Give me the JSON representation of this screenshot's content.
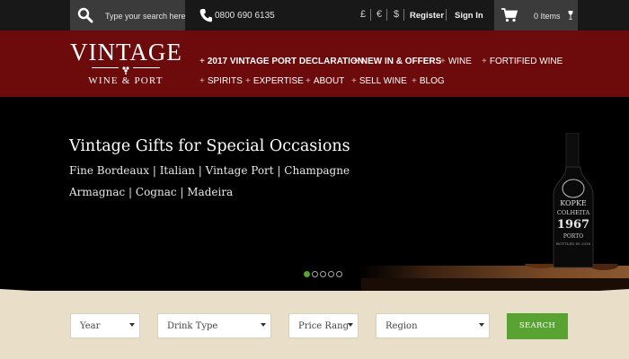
{
  "topbar": {
    "search_placeholder": "Type your search here",
    "phone": "0800 690 6135",
    "currencies": [
      "£",
      "€",
      "$"
    ],
    "register_label": "Register",
    "signin_label": "Sign In",
    "basket_label": "0 Items"
  },
  "logo": {
    "main": "VINTAGE",
    "sub": "WINE & PORT"
  },
  "nav": {
    "items": [
      {
        "label": "2017 VINTAGE PORT DECLARATION"
      },
      {
        "label": "NEW IN & OFFERS"
      },
      {
        "label": "WINE"
      },
      {
        "label": "FORTIFIED WINE"
      },
      {
        "label": "SPIRITS"
      },
      {
        "label": "EXPERTISE"
      },
      {
        "label": "ABOUT"
      },
      {
        "label": "SELL WINE"
      },
      {
        "label": "BLOG"
      }
    ]
  },
  "hero": {
    "title": "Vintage Gifts for Special Occasions",
    "line1": "Fine Bordeaux | Italian | Vintage Port | Champagne",
    "line2": "Armagnac | Cognac | Madeira",
    "bottle_label": [
      "KOPKE",
      "COLHEITA",
      "1967",
      "PORTO",
      "BOTTLED IN 2016"
    ],
    "slides": 5,
    "active_slide": 1
  },
  "filters": {
    "year": "Year",
    "drink_type": "Drink Type",
    "price_range": "Price Rang",
    "region": "Region",
    "search_button": "SEARCH"
  },
  "colors": {
    "header_red": "#6c0a0c",
    "accent_green": "#5aa328",
    "topbar_dark": "#181818",
    "cream": "#e9dfc9"
  }
}
